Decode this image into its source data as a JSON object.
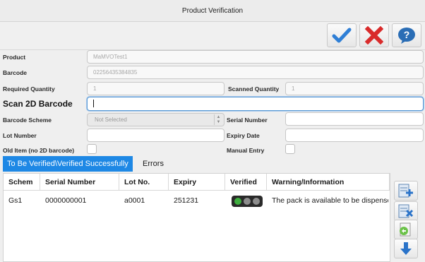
{
  "window": {
    "title": "Product Verification"
  },
  "toolbar": {
    "accept_icon": "checkmark-icon",
    "cancel_icon": "red-x-icon",
    "help_icon": "question-bubble-icon",
    "accept_color": "#2f7fd6",
    "cancel_color": "#d92b2b",
    "help_color": "#2a6db5"
  },
  "form": {
    "product": {
      "label": "Product",
      "value": "MaMVOTest1"
    },
    "barcode": {
      "label": "Barcode",
      "value": "02256435384835"
    },
    "required_quantity": {
      "label": "Required Quantity",
      "value": "1"
    },
    "scanned_quantity": {
      "label": "Scanned Quantity",
      "value": "1"
    },
    "scan_2d": {
      "label": "Scan 2D Barcode",
      "value": ""
    },
    "barcode_scheme": {
      "label": "Barcode Scheme",
      "value": "Not Selected"
    },
    "serial_number": {
      "label": "Serial Number",
      "value": ""
    },
    "lot_number": {
      "label": "Lot Number",
      "value": ""
    },
    "expiry_date": {
      "label": "Expiry Date",
      "value": ""
    },
    "old_item": {
      "label": "Old Item (no 2D barcode)",
      "checked": false
    },
    "manual_entry": {
      "label": "Manual Entry",
      "checked": false
    }
  },
  "tabs": [
    {
      "label": "To Be Verified\\Verified Successfully",
      "active": true
    },
    {
      "label": "Errors",
      "active": false
    }
  ],
  "grid": {
    "columns": [
      "Schem",
      "Serial Number",
      "Lot No.",
      "Expiry",
      "Verified",
      "Warning/Information"
    ],
    "rows": [
      {
        "schem": "Gs1",
        "serial_number": "0000000001",
        "lot_no": "a0001",
        "expiry": "251231",
        "verified_lights": [
          "#3fae3f",
          "#8d8d8d",
          "#8d8d8d"
        ],
        "warning": "The pack is available to be dispensed"
      }
    ]
  },
  "side_buttons": [
    {
      "icon": "add-row-icon"
    },
    {
      "icon": "delete-row-icon"
    },
    {
      "icon": "undo-icon"
    },
    {
      "icon": "arrow-down-icon"
    }
  ]
}
